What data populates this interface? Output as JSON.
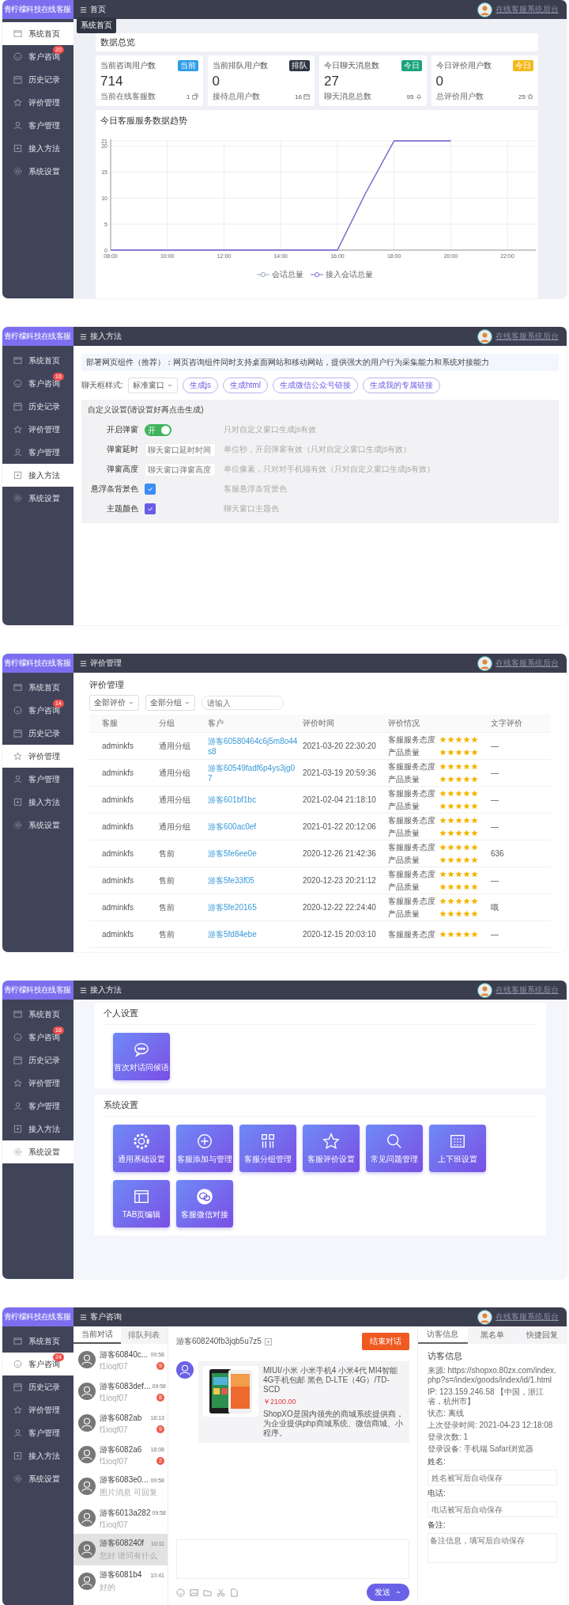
{
  "panels": [
    {
      "kind": "dashboard",
      "brand": "青柠檬科技在线客服",
      "breadcrumb": "首页",
      "tooltip": "系统首页",
      "user": "在线客服系统后台",
      "sidebar": [
        {
          "label": "系统首页",
          "selected": true
        },
        {
          "label": "客户咨询",
          "selected": false,
          "badge": "20"
        },
        {
          "label": "历史记录",
          "selected": false
        },
        {
          "label": "评价管理",
          "selected": false
        },
        {
          "label": "客户管理",
          "selected": false
        },
        {
          "label": "接入方法",
          "selected": false
        },
        {
          "label": "系统设置",
          "selected": false
        }
      ],
      "title": "数据总览",
      "stats": [
        {
          "label": "当前咨询用户数",
          "tag": "当前",
          "color": "#2d9ce6",
          "value": "714",
          "footer": "当前在线客服数",
          "footer_value": "1"
        },
        {
          "label": "当前排队用户数",
          "tag": "排队",
          "color": "#2f3542",
          "value": "0",
          "footer": "接待总用户数",
          "footer_value": "16"
        },
        {
          "label": "今日聊天消息数",
          "tag": "今日",
          "color": "#1aa37a",
          "value": "27",
          "footer": "聊天消息总数",
          "footer_value": "95"
        },
        {
          "label": "今日评价用户数",
          "tag": "今日",
          "color": "#f5b919",
          "value": "0",
          "footer": "总评价用户数",
          "footer_value": "25"
        }
      ],
      "chart": {
        "chart_data": {
          "type": "line",
          "title": "今日客服服务数据趋势",
          "x": [
            8,
            9,
            10,
            11,
            12,
            13,
            14,
            15,
            16,
            17,
            18,
            19,
            20
          ],
          "series": [
            {
              "name": "会话总量",
              "color": "#9aa4b8",
              "values": [
                0,
                0,
                0,
                0,
                0,
                0,
                0,
                0,
                0,
                11,
                21,
                21,
                21
              ]
            },
            {
              "name": "接入会话总量",
              "color": "#7b6fd6",
              "values": [
                0,
                0,
                0,
                0,
                0,
                0,
                0,
                0,
                0,
                11,
                21,
                21,
                21
              ]
            }
          ],
          "xlim": [
            8,
            23
          ],
          "ylim": [
            0,
            21
          ],
          "xticks": [
            {
              "value": 8,
              "label": "08:00"
            },
            {
              "value": 10,
              "label": "10:00"
            },
            {
              "value": 12,
              "label": "12:00"
            },
            {
              "value": 14,
              "label": "14:00"
            },
            {
              "value": 16,
              "label": "16:00"
            },
            {
              "value": 18,
              "label": "18:00"
            },
            {
              "value": 20,
              "label": "20:00"
            },
            {
              "value": 22,
              "label": "22:00"
            }
          ],
          "yticks": [
            0,
            5,
            10,
            15,
            20,
            21
          ],
          "grid": true,
          "legend": true
        }
      }
    },
    {
      "kind": "integration",
      "brand": "青柠檬科技在线客服",
      "breadcrumb": "接入方法",
      "user": "在线客服系统后台",
      "sidebar": [
        {
          "label": "系统首页",
          "selected": false
        },
        {
          "label": "客户咨询",
          "selected": false,
          "badge": "16"
        },
        {
          "label": "历史记录",
          "selected": false
        },
        {
          "label": "评价管理",
          "selected": false
        },
        {
          "label": "客户管理",
          "selected": false
        },
        {
          "label": "接入方法",
          "selected": true
        },
        {
          "label": "系统设置",
          "selected": false
        }
      ],
      "notice": "部署网页组件（推荐）：网页咨询组件同时支持桌面网站和移动网站，提供强大的用户行为采集能力和系统对接能力",
      "style_label": "聊天框样式:",
      "style_value": "标准窗口",
      "buttons": [
        "生成js",
        "生成html",
        "生成微信公众号链接",
        "生成我的专属链接"
      ],
      "custom_title": "自定义设置(请设置好再点击生成)",
      "fields": [
        {
          "kind": "toggle",
          "label": "开启弹窗",
          "on": true,
          "toggle_text": "开",
          "hint": "只对自定义窗口生成js有效"
        },
        {
          "kind": "input",
          "label": "弹窗延时",
          "placeholder": "聊天窗口延时时间",
          "hint": "单位秒，开启弹窗有效（只对自定义窗口生成js有效）"
        },
        {
          "kind": "input",
          "label": "弹窗高度",
          "placeholder": "聊天窗口弹窗高度",
          "hint": "单位像素，只对对手机端有效（只对自定义窗口生成js有效）"
        },
        {
          "kind": "color",
          "label": "悬浮条背景色",
          "color": "#3b8df5",
          "hint": "客服悬浮条背景色"
        },
        {
          "kind": "color",
          "label": "主题颜色",
          "color": "#6a5ce8",
          "hint": "聊天窗口主题色"
        }
      ]
    },
    {
      "kind": "ratings",
      "brand": "青柠檬科技在线客服",
      "breadcrumb": "评价管理",
      "user": "在线客服系统后台",
      "sidebar": [
        {
          "label": "系统首页",
          "selected": false
        },
        {
          "label": "客户咨询",
          "selected": false,
          "badge": "14"
        },
        {
          "label": "历史记录",
          "selected": false
        },
        {
          "label": "评价管理",
          "selected": true
        },
        {
          "label": "客户管理",
          "selected": false
        },
        {
          "label": "接入方法",
          "selected": false
        },
        {
          "label": "系统设置",
          "selected": false
        }
      ],
      "title": "评价管理",
      "filters": [
        "全部评价",
        "全部分组"
      ],
      "search_placeholder": "请输入",
      "columns": [
        "客服",
        "分组",
        "客户",
        "评价时间",
        "评价情况",
        "文字评价"
      ],
      "rows": [
        {
          "agent": "adminkfs",
          "group": "通用分组",
          "customer": "游客60580464c6j5m8o44s8",
          "time": "2021-03-20 22:30:20",
          "ratings": [
            {
              "label": "客服服务态度",
              "stars": 5
            },
            {
              "label": "产品质量",
              "stars": 5
            }
          ],
          "comment": "—"
        },
        {
          "agent": "adminkfs",
          "group": "通用分组",
          "customer": "游客60549fadf6p4ys3jg07",
          "time": "2021-03-19 20:59:36",
          "ratings": [
            {
              "label": "客服服务态度",
              "stars": 5
            },
            {
              "label": "产品质量",
              "stars": 5
            }
          ],
          "comment": "—"
        },
        {
          "agent": "adminkfs",
          "group": "通用分组",
          "customer": "游客601bf1bc",
          "time": "2021-02-04 21:18:10",
          "ratings": [
            {
              "label": "客服服务态度",
              "stars": 5
            },
            {
              "label": "产品质量",
              "stars": 5
            }
          ],
          "comment": "—"
        },
        {
          "agent": "adminkfs",
          "group": "通用分组",
          "customer": "游客600ac0ef",
          "time": "2021-01-22 20:12:06",
          "ratings": [
            {
              "label": "客服服务态度",
              "stars": 5
            },
            {
              "label": "产品质量",
              "stars": 5
            }
          ],
          "comment": "—"
        },
        {
          "agent": "adminkfs",
          "group": "售前",
          "customer": "游客5fe6ee0e",
          "time": "2020-12-26 21:42:36",
          "ratings": [
            {
              "label": "客服服务态度",
              "stars": 5
            },
            {
              "label": "产品质量",
              "stars": 5
            }
          ],
          "comment": "636"
        },
        {
          "agent": "adminkfs",
          "group": "售前",
          "customer": "游客5fe33f05",
          "time": "2020-12-23 20:21:12",
          "ratings": [
            {
              "label": "客服服务态度",
              "stars": 5
            },
            {
              "label": "产品质量",
              "stars": 5
            }
          ],
          "comment": "—"
        },
        {
          "agent": "adminkfs",
          "group": "售前",
          "customer": "游客5fe20165",
          "time": "2020-12-22 22:24:40",
          "ratings": [
            {
              "label": "客服服务态度",
              "stars": 5
            },
            {
              "label": "产品质量",
              "stars": 5
            }
          ],
          "comment": "哦"
        },
        {
          "agent": "adminkfs",
          "group": "售前",
          "customer": "游客5fd84ebe",
          "time": "2020-12-15 20:03:10",
          "ratings": [
            {
              "label": "客服服务态度",
              "stars": 5
            }
          ],
          "comment": "—"
        }
      ]
    },
    {
      "kind": "settings",
      "brand": "青柠檬科技在线客服",
      "breadcrumb": "接入方法",
      "user": "在线客服系统后台",
      "sidebar": [
        {
          "label": "系统首页",
          "selected": false
        },
        {
          "label": "客户咨询",
          "selected": false,
          "badge": "16"
        },
        {
          "label": "历史记录",
          "selected": false
        },
        {
          "label": "评价管理",
          "selected": false
        },
        {
          "label": "客户管理",
          "selected": false
        },
        {
          "label": "接入方法",
          "selected": false
        },
        {
          "label": "系统设置",
          "selected": true
        }
      ],
      "sections": [
        {
          "title": "个人设置",
          "tiles": [
            {
              "kind": "chat",
              "label": "首次对话问候语"
            }
          ]
        },
        {
          "title": "系统设置",
          "tiles": [
            {
              "kind": "gear",
              "label": "通用基础设置"
            },
            {
              "kind": "plus",
              "label": "客服添加与管理"
            },
            {
              "kind": "columns",
              "label": "客服分组管理"
            },
            {
              "kind": "star",
              "label": "客服评价设置"
            },
            {
              "kind": "search",
              "label": "常见问题管理"
            },
            {
              "kind": "calendar",
              "label": "上下班设置"
            },
            {
              "kind": "window",
              "label": "TAB页编辑"
            },
            {
              "kind": "wechat",
              "label": "客服微信对接"
            }
          ]
        }
      ]
    },
    {
      "kind": "chat",
      "brand": "青柠檬科技在线客服",
      "breadcrumb": "客户咨询",
      "user": "在线客服系统后台",
      "sidebar": [
        {
          "label": "系统首页",
          "selected": false
        },
        {
          "label": "客户咨询",
          "selected": true,
          "badge": "24"
        },
        {
          "label": "历史记录",
          "selected": false
        },
        {
          "label": "评价管理",
          "selected": false
        },
        {
          "label": "客户管理",
          "selected": false
        },
        {
          "label": "接入方法",
          "selected": false
        },
        {
          "label": "系统设置",
          "selected": false
        }
      ],
      "list_tabs": [
        {
          "label": "当前对话",
          "selected": true
        },
        {
          "label": "排队列表",
          "selected": false
        }
      ],
      "conversations": [
        {
          "name": "游客60840c...",
          "time": "09:58",
          "preview": "f1ioqf07",
          "badge": "9",
          "selected": false
        },
        {
          "name": "游客6083def...",
          "time": "09:58",
          "preview": "f1ioqf07",
          "badge": "8",
          "selected": false
        },
        {
          "name": "游客6082ab",
          "time": "18:13",
          "preview": "f1ioqf07",
          "badge": "9",
          "selected": false
        },
        {
          "name": "游客6082a6",
          "time": "18:08",
          "preview": "f1ioqf07",
          "badge": "2",
          "selected": false
        },
        {
          "name": "游客6083e0...",
          "time": "09:58",
          "preview": "图片消息 可回复",
          "selected": false
        },
        {
          "name": "游客6013a282",
          "time": "09:58",
          "preview": "f1ioqf07",
          "selected": false
        },
        {
          "name": "游客608240f",
          "time": "10:11",
          "preview": "您好 请问有什么",
          "selected": true
        },
        {
          "name": "游客6081b4",
          "time": "10:41",
          "preview": "好的",
          "selected": false
        }
      ],
      "visitor": "游客608240fb3jqb5u7z5",
      "end_button": "结束对话",
      "message": {
        "title": "MIUI/小米 小米手机4 小米4代 MI4智能4G手机包邮 黑色 D-LTE（4G）/TD-SCD",
        "price": "￥2100.00",
        "desc": "ShopXO是国内领先的商城系统提供商，为企业提供php商城系统、微信商城、小程序。"
      },
      "send_button": "发送",
      "info_tabs": [
        {
          "label": "访客信息",
          "selected": true
        },
        {
          "label": "黑名单",
          "selected": false
        },
        {
          "label": "快捷回复",
          "selected": false
        }
      ],
      "info_title": "访客信息",
      "info": [
        "来源: https://shopxo.80zx.com/index.php?s=/index/goods/index/id/1.html",
        "IP: 123.159.246.58 【中国，浙江省，杭州市】",
        "状态: 离线",
        "上次登录时间: 2021-04-23 12:18:08",
        "登录次数: 1",
        "登录设备: 手机端 Safari浏览器"
      ],
      "inputs": [
        {
          "kind": "input",
          "label": "姓名:",
          "placeholder": "姓名被写后自动保存"
        },
        {
          "kind": "input",
          "label": "电话:",
          "placeholder": "电话被写后自动保存"
        },
        {
          "kind": "textarea",
          "label": "备注:",
          "placeholder": "备注信息，填写后自动保存"
        }
      ]
    }
  ]
}
